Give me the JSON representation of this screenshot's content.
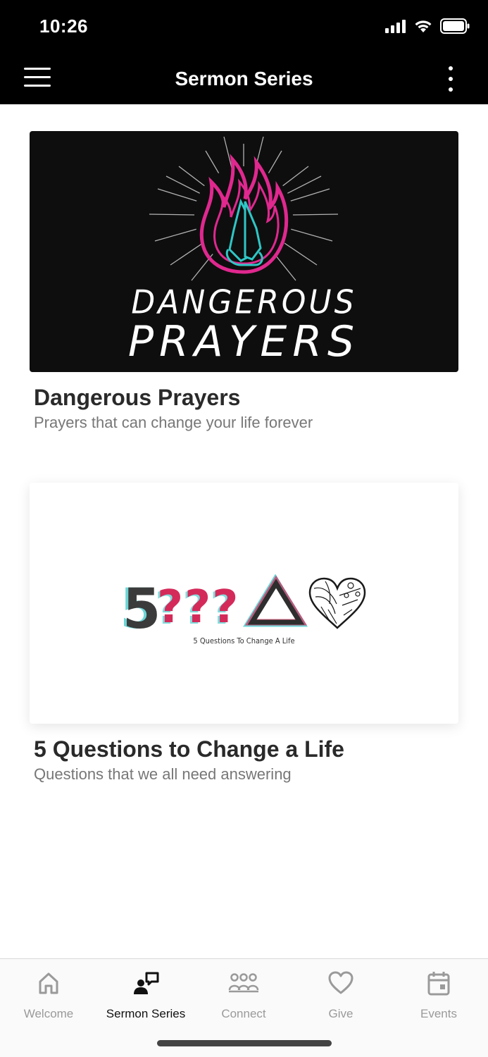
{
  "status_bar": {
    "time": "10:26"
  },
  "nav": {
    "title": "Sermon Series"
  },
  "series": [
    {
      "art_line1": "DANGEROUS",
      "art_line2": "PRAYERS",
      "title": "Dangerous Prayers",
      "subtitle": "Prayers that can change your life forever"
    },
    {
      "art_number": "5",
      "art_marks": "???",
      "art_caption": "5 Questions To Change A Life",
      "title": "5 Questions to Change a Life",
      "subtitle": "Questions that we all need answering"
    }
  ],
  "tabs": [
    {
      "label": "Welcome",
      "icon": "home-icon"
    },
    {
      "label": "Sermon Series",
      "icon": "speaker-icon"
    },
    {
      "label": "Connect",
      "icon": "group-icon"
    },
    {
      "label": "Give",
      "icon": "heart-icon"
    },
    {
      "label": "Events",
      "icon": "calendar-icon"
    }
  ],
  "colors": {
    "accent_pink": "#e0288f",
    "accent_cyan": "#2fc6c6",
    "active_tab": "#111111",
    "inactive_tab": "#9a9a9a"
  }
}
